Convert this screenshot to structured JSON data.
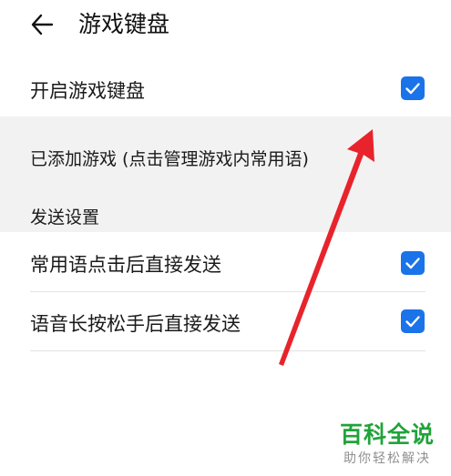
{
  "header": {
    "title": "游戏键盘"
  },
  "settings": {
    "enable_game_keyboard": {
      "label": "开启游戏键盘",
      "checked": true
    },
    "added_games_label": "已添加游戏 (点击管理游戏内常用语)",
    "send_settings_label": "发送设置",
    "phrase_send": {
      "label": "常用语点击后直接发送",
      "checked": true
    },
    "voice_send": {
      "label": "语音长按松手后直接发送",
      "checked": true
    }
  },
  "colors": {
    "accent": "#1a73e8",
    "section_bg": "#f2f2f2",
    "arrow": "#e8232b",
    "watermark": "#21a33a"
  },
  "watermark": {
    "title": "百科全说",
    "subtitle": "助你轻松解决"
  }
}
